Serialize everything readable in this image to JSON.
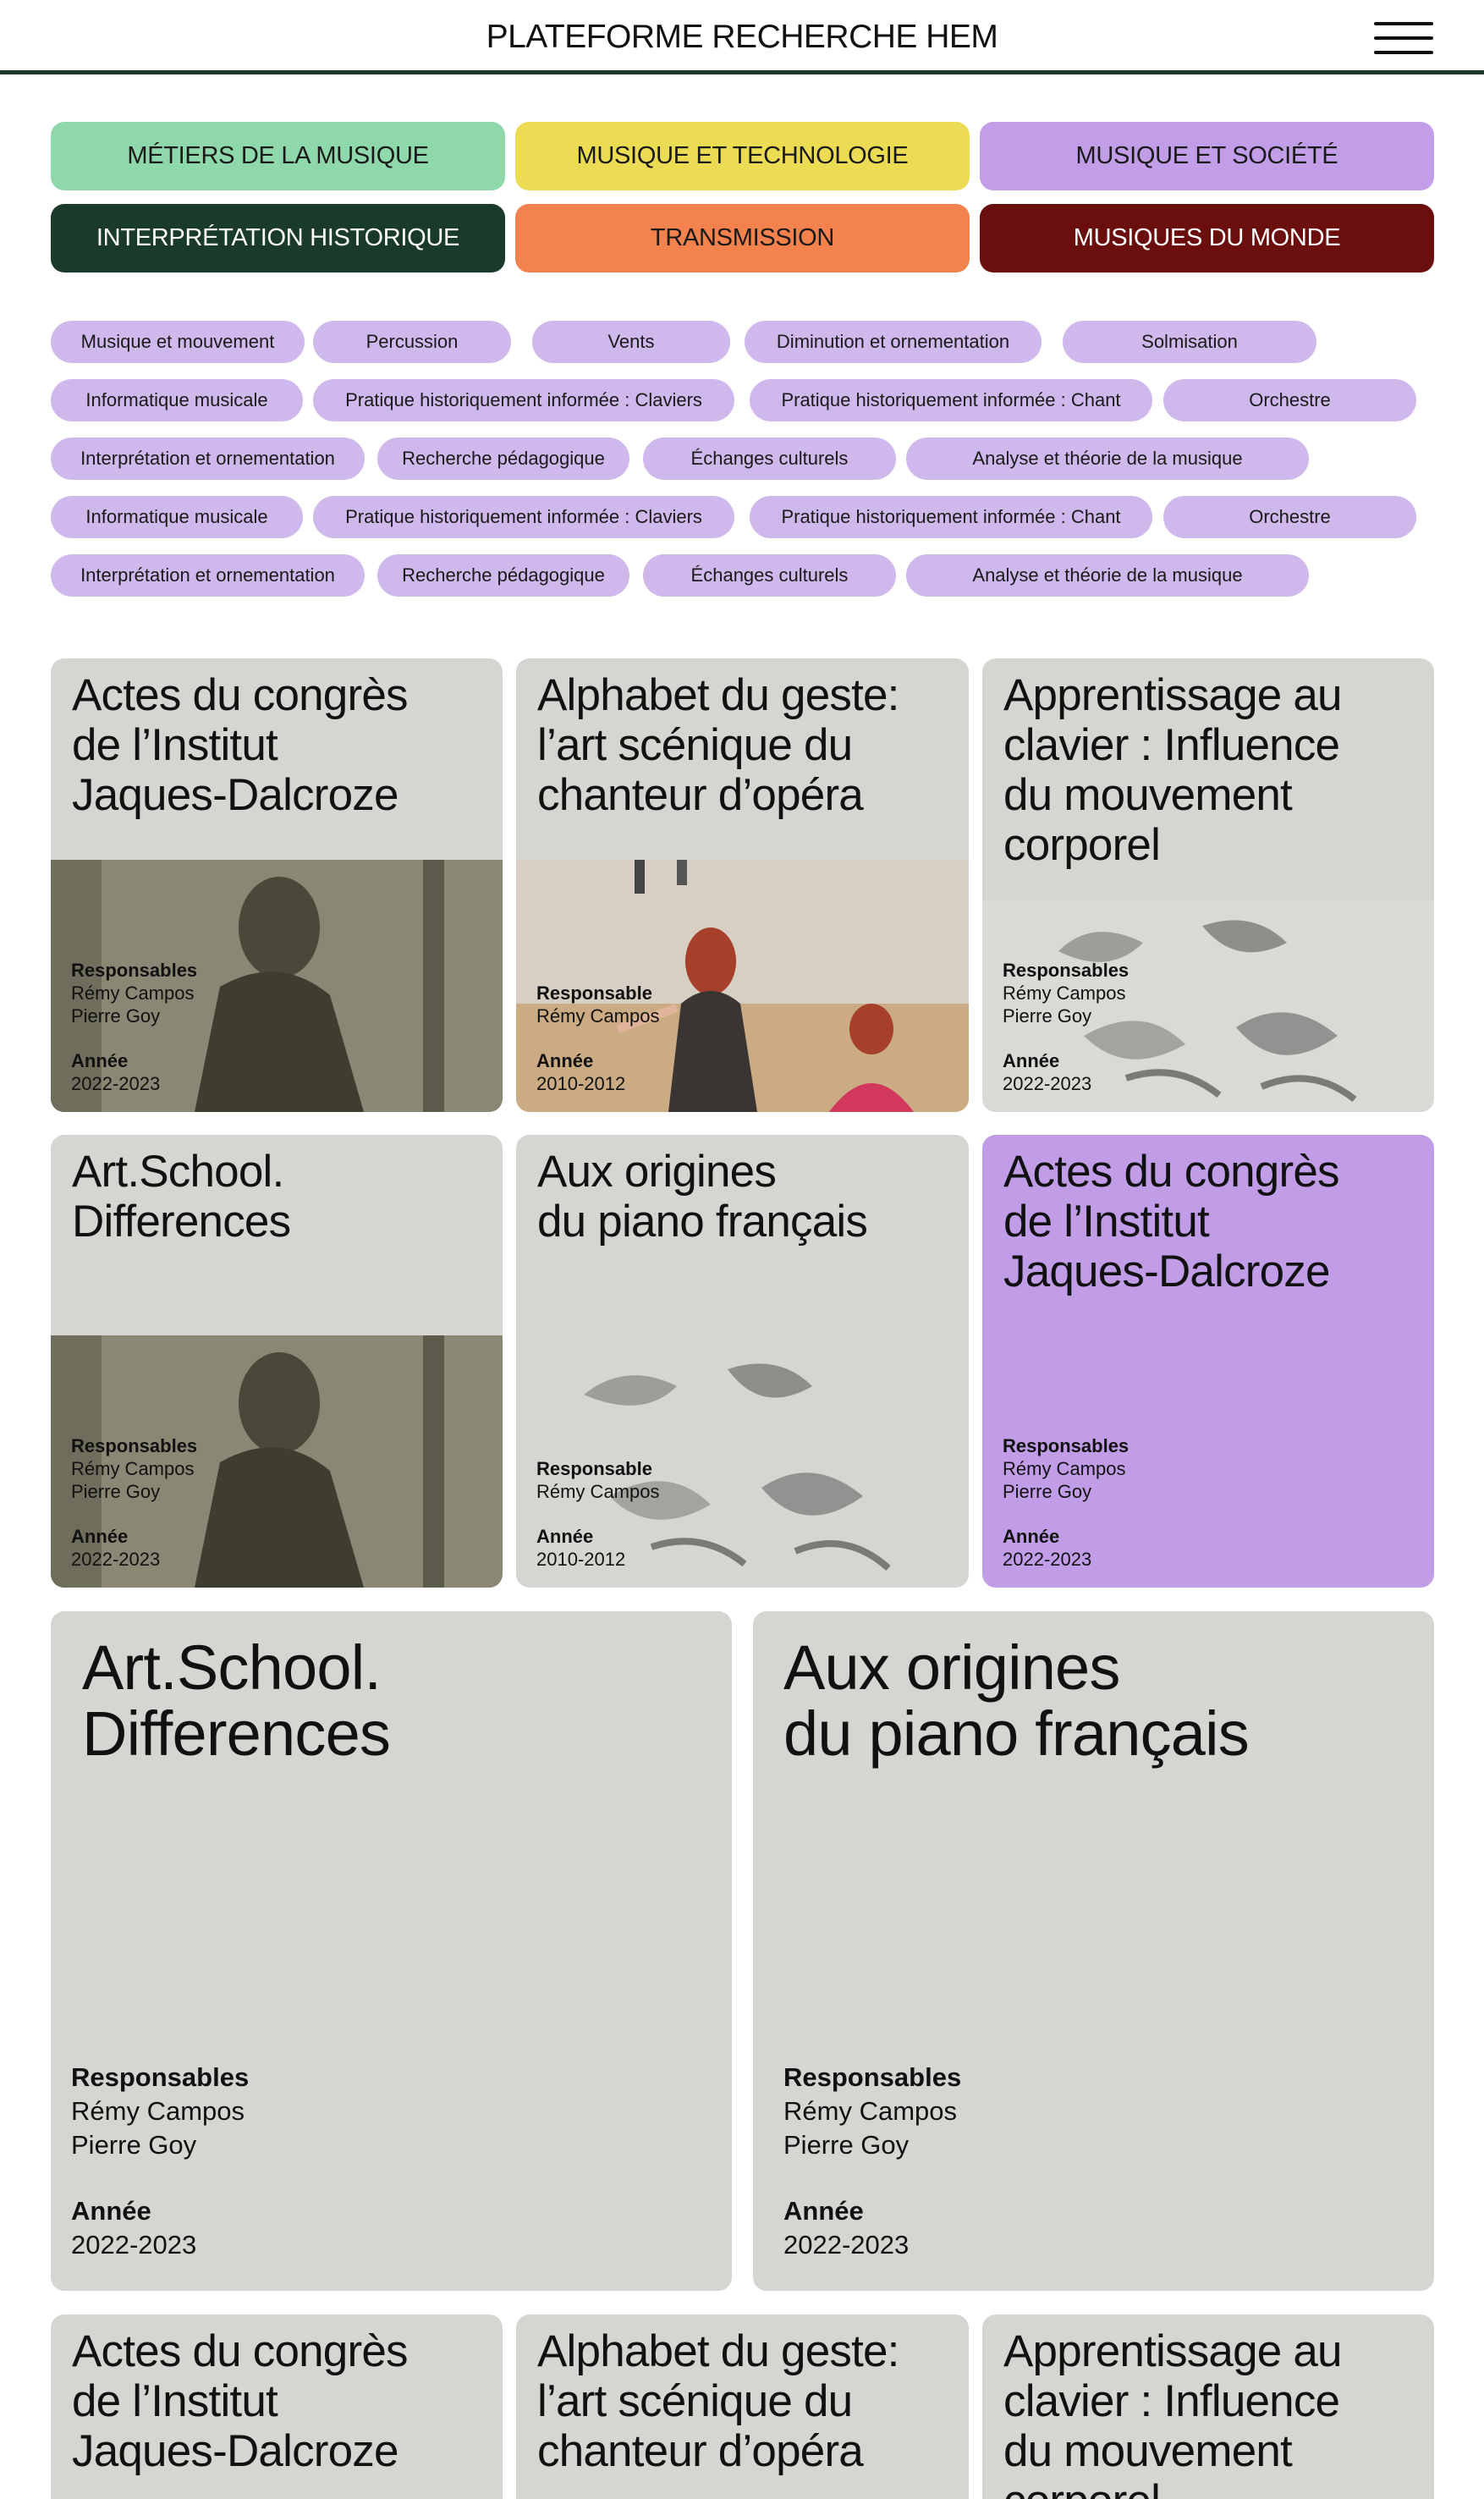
{
  "header": {
    "title": "PLATEFORME RECHERCHE HEM"
  },
  "categories": [
    {
      "label": "MÉTIERS DE LA MUSIQUE",
      "bg": "#8fd8ab",
      "fg": "#1a1a1a"
    },
    {
      "label": "MUSIQUE ET TECHNOLOGIE",
      "bg": "#ecdc54",
      "fg": "#1a1a1a"
    },
    {
      "label": "MUSIQUE ET SOCIÉTÉ",
      "bg": "#c29ee9",
      "fg": "#1a1a1a"
    },
    {
      "label": "INTERPRÉTATION HISTORIQUE",
      "bg": "#1a3a2a",
      "fg": "#ffffff"
    },
    {
      "label": "TRANSMISSION",
      "bg": "#f4824f",
      "fg": "#1a1a1a"
    },
    {
      "label": "MUSIQUES DU MONDE",
      "bg": "#6a0f0d",
      "fg": "#ffffff"
    }
  ],
  "tags": [
    "Musique et mouvement",
    "Percussion",
    "Vents",
    "Diminution et ornementation",
    "Solmisation",
    "Informatique musicale",
    "Pratique historiquement informée : Claviers",
    "Pratique historiquement informée : Chant",
    "Orchestre",
    "Interprétation et ornementation",
    "Recherche pédagogique",
    "Échanges culturels",
    "Analyse et théorie de la musique",
    "Informatique musicale",
    "Pratique historiquement informée : Claviers",
    "Pratique historiquement informée : Chant",
    "Orchestre",
    "Interprétation et ornementation",
    "Recherche pédagogique",
    "Échanges culturels",
    "Analyse et théorie de la musique"
  ],
  "labels": {
    "responsables": "Responsables",
    "responsable": "Responsable",
    "annee": "Année"
  },
  "cards": [
    {
      "title": "Actes du congrès\nde l’Institut\nJaques-Dalcroze",
      "people": [
        "Rémy Campos",
        "Pierre Goy"
      ],
      "year": "2022-2023",
      "image": "photo-man"
    },
    {
      "title": "Alphabet du geste:\nl’art scénique du\nchanteur d’opéra",
      "people": [
        "Rémy Campos"
      ],
      "year": "2010-2012",
      "image": "photo-dance"
    },
    {
      "title": "Apprentissage au\nclavier : Influence\ndu mouvement\ncorporel",
      "people": [
        "Rémy Campos",
        "Pierre Goy"
      ],
      "year": "2022-2023",
      "image": "hands-sketch"
    },
    {
      "title": "Art.School.\nDifferences",
      "people": [
        "Rémy Campos",
        "Pierre Goy"
      ],
      "year": "2022-2023",
      "image": "photo-man"
    },
    {
      "title": "Aux origines\ndu piano français",
      "people": [
        "Rémy Campos"
      ],
      "year": "2010-2012",
      "image": "hands-sketch"
    },
    {
      "title": "Actes du congrès\nde l’Institut\nJaques-Dalcroze",
      "people": [
        "Rémy Campos",
        "Pierre Goy"
      ],
      "year": "2022-2023",
      "image": "none"
    },
    {
      "title": "Art.School.\nDifferences",
      "people": [
        "Rémy Campos",
        "Pierre Goy"
      ],
      "year": "2022-2023",
      "image": "none"
    },
    {
      "title": "Aux origines\ndu piano français",
      "people": [
        "Rémy Campos",
        "Pierre Goy"
      ],
      "year": "2022-2023",
      "image": "none"
    },
    {
      "title": "Actes du congrès\nde l’Institut\nJaques-Dalcroze",
      "people": [],
      "year": "",
      "image": "none"
    },
    {
      "title": "Alphabet du geste:\nl’art scénique du\nchanteur d’opéra",
      "people": [],
      "year": "",
      "image": "none"
    },
    {
      "title": "Apprentissage au\nclavier : Influence\ndu mouvement\ncorporel",
      "people": [],
      "year": "",
      "image": "none"
    }
  ]
}
